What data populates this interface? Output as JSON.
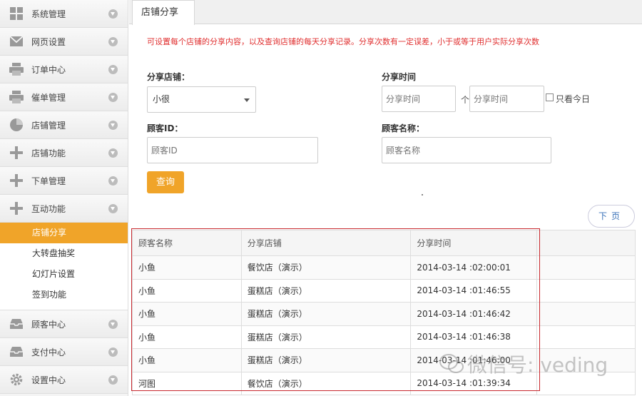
{
  "sidebar": {
    "items": [
      {
        "label": "系统管理",
        "icon": "grid-icon"
      },
      {
        "label": "网页设置",
        "icon": "mail-icon"
      },
      {
        "label": "订单中心",
        "icon": "printer-icon"
      },
      {
        "label": "催单管理",
        "icon": "printer-icon"
      },
      {
        "label": "店铺管理",
        "icon": "pie-chart-icon"
      },
      {
        "label": "店铺功能",
        "icon": "plus-icon"
      },
      {
        "label": "下单管理",
        "icon": "plus-icon"
      },
      {
        "label": "互动功能",
        "icon": "plus-icon"
      }
    ],
    "submenu": [
      "店铺分享",
      "大转盘抽奖",
      "幻灯片设置",
      "签到功能"
    ],
    "items_bottom": [
      {
        "label": "顾客中心",
        "icon": "inbox-icon"
      },
      {
        "label": "支付中心",
        "icon": "inbox-icon"
      },
      {
        "label": "设置中心",
        "icon": "gear-icon"
      }
    ]
  },
  "tab": {
    "label": "店铺分享"
  },
  "notice": "可设置每个店铺的分享内容，以及查询店铺的每天分享记录。分享次数有一定误差，小于或等于用户实际分享次数",
  "filters": {
    "shop_label": "分享店铺：",
    "shop_value": "小很",
    "time_label": "分享时间",
    "time_start_placeholder": "分享时间",
    "separator": "个",
    "time_end_placeholder": "分享时间",
    "only_today_label": "只看今日",
    "customer_id_label": "顾客ID：",
    "customer_id_placeholder": "顾客ID",
    "customer_name_label": "顾客名称：",
    "customer_name_placeholder": "顾客名称"
  },
  "query_button": "查询",
  "pager": {
    "next_label": "下页"
  },
  "table": {
    "headers": [
      "顾客名称",
      "分享店铺",
      "分享时间",
      ""
    ],
    "rows": [
      [
        "小鱼",
        "餐饮店（演示）",
        "2014-03-14 :02:00:01"
      ],
      [
        "小鱼",
        "蛋糕店（演示）",
        "2014-03-14 :01:46:55"
      ],
      [
        "小鱼",
        "蛋糕店（演示）",
        "2014-03-14 :01:46:42"
      ],
      [
        "小鱼",
        "蛋糕店（演示）",
        "2014-03-14 :01:46:38"
      ],
      [
        "小鱼",
        "蛋糕店（演示）",
        "2014-03-14 :01:46:00"
      ],
      [
        "河图",
        "餐饮店（演示）",
        "2014-03-14 :01:39:34"
      ]
    ]
  },
  "watermark": "微信号: veding",
  "colors": {
    "accent": "#f0a429",
    "notice": "#e03030",
    "frame": "#c8282e"
  }
}
